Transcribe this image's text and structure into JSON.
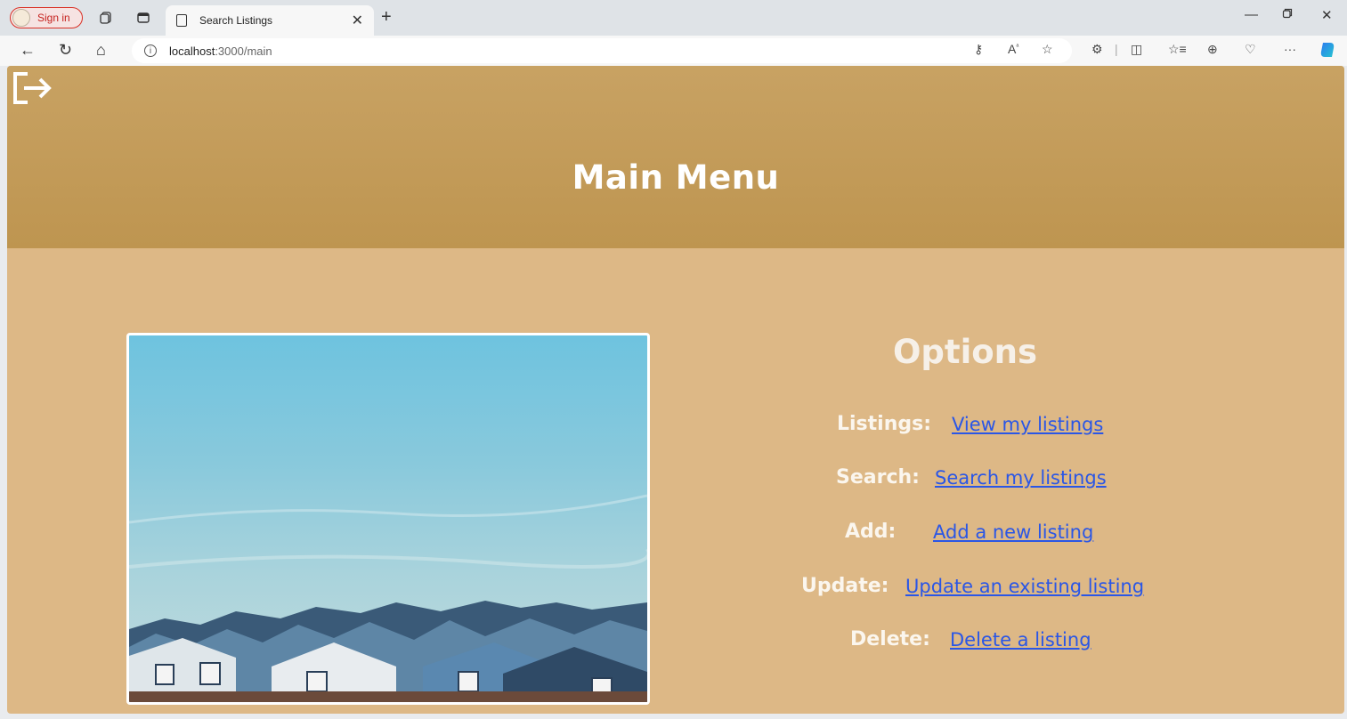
{
  "browser": {
    "sign_in_label": "Sign in",
    "tab_title": "Search Listings",
    "url_host": "localhost",
    "url_rest": ":3000/main",
    "icons": {
      "workspaces": "workspaces-icon",
      "tab_actions": "tab-actions-icon",
      "read_aloud": "read-aloud-icon",
      "favorites": "favorites-star-icon",
      "extensions": "extensions-icon",
      "split_screen": "split-screen-icon",
      "favorites_list": "favorites-list-icon",
      "collections": "collections-icon",
      "health": "browser-essentials-icon",
      "more": "more-icon",
      "copilot": "copilot-icon"
    }
  },
  "header": {
    "title": "Main Menu"
  },
  "options": {
    "title": "Options",
    "items": [
      {
        "label": "Listings:",
        "link": "View my listings"
      },
      {
        "label": "Search:",
        "link": "Search my listings"
      },
      {
        "label": "Add:",
        "link": "Add a new listing"
      },
      {
        "label": "Update:",
        "link": "Update an existing listing"
      },
      {
        "label": "Delete:",
        "link": "Delete a listing"
      }
    ]
  },
  "colors": {
    "header": "#c19b5a",
    "page_bg": "#ddb886",
    "link": "#2a56e6",
    "text": "#ffffff"
  }
}
